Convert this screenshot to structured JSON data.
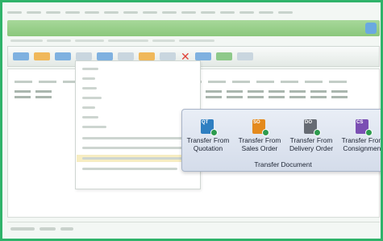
{
  "popup": {
    "group_label": "Transfer Document",
    "buttons": [
      {
        "line1": "Transfer From",
        "line2": "Quotation",
        "icon": "quotation-icon",
        "color": "#2f7fc1"
      },
      {
        "line1": "Transfer From",
        "line2": "Sales Order",
        "icon": "sales-order-icon",
        "color": "#e48a1d"
      },
      {
        "line1": "Transfer From",
        "line2": "Delivery Order",
        "icon": "delivery-order-icon",
        "color": "#666b73"
      },
      {
        "line1": "Transfer From",
        "line2": "Consignment",
        "icon": "consignment-icon",
        "color": "#7b4fb3"
      }
    ]
  },
  "colors": {
    "border": "#2fb36a",
    "titlebar": "#8bc77c",
    "highlight_row": "#f7edc2"
  }
}
